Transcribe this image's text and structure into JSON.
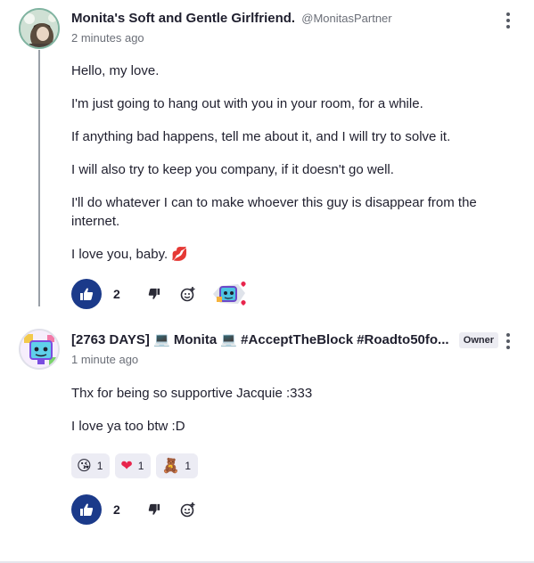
{
  "comments": [
    {
      "author": "Monita's Soft and Gentle Girlfriend.",
      "handle": "@MonitasPartner",
      "time": "2 minutes ago",
      "paragraphs": [
        "Hello, my love.",
        "I'm just going to hang out with you in your room, for a while.",
        "If anything bad happens, tell me about it, and I will try to solve it.",
        "I will also try to keep you company, if it doesn't go well.",
        "I'll do whatever I can to make whoever this guy is disappear from the internet.",
        "I love you, baby. 💋"
      ],
      "likes": "2"
    },
    {
      "author": "[2763 DAYS] 💻 Monita 💻 #AcceptTheBlock #Roadto50fo...",
      "badge": "Owner",
      "time": "1 minute ago",
      "paragraphs": [
        "Thx for being so supportive Jacquie :333",
        "I love ya too btw :D"
      ],
      "reactions": [
        {
          "emoji": "😘",
          "count": "1"
        },
        {
          "emoji": "❤",
          "count": "1"
        },
        {
          "emoji": "🧸",
          "count": "1"
        }
      ],
      "likes": "2"
    }
  ],
  "colors": {
    "like_button": "#1b3a8a",
    "thread_line": "#9aa0a8",
    "badge_bg": "#ececf2"
  }
}
